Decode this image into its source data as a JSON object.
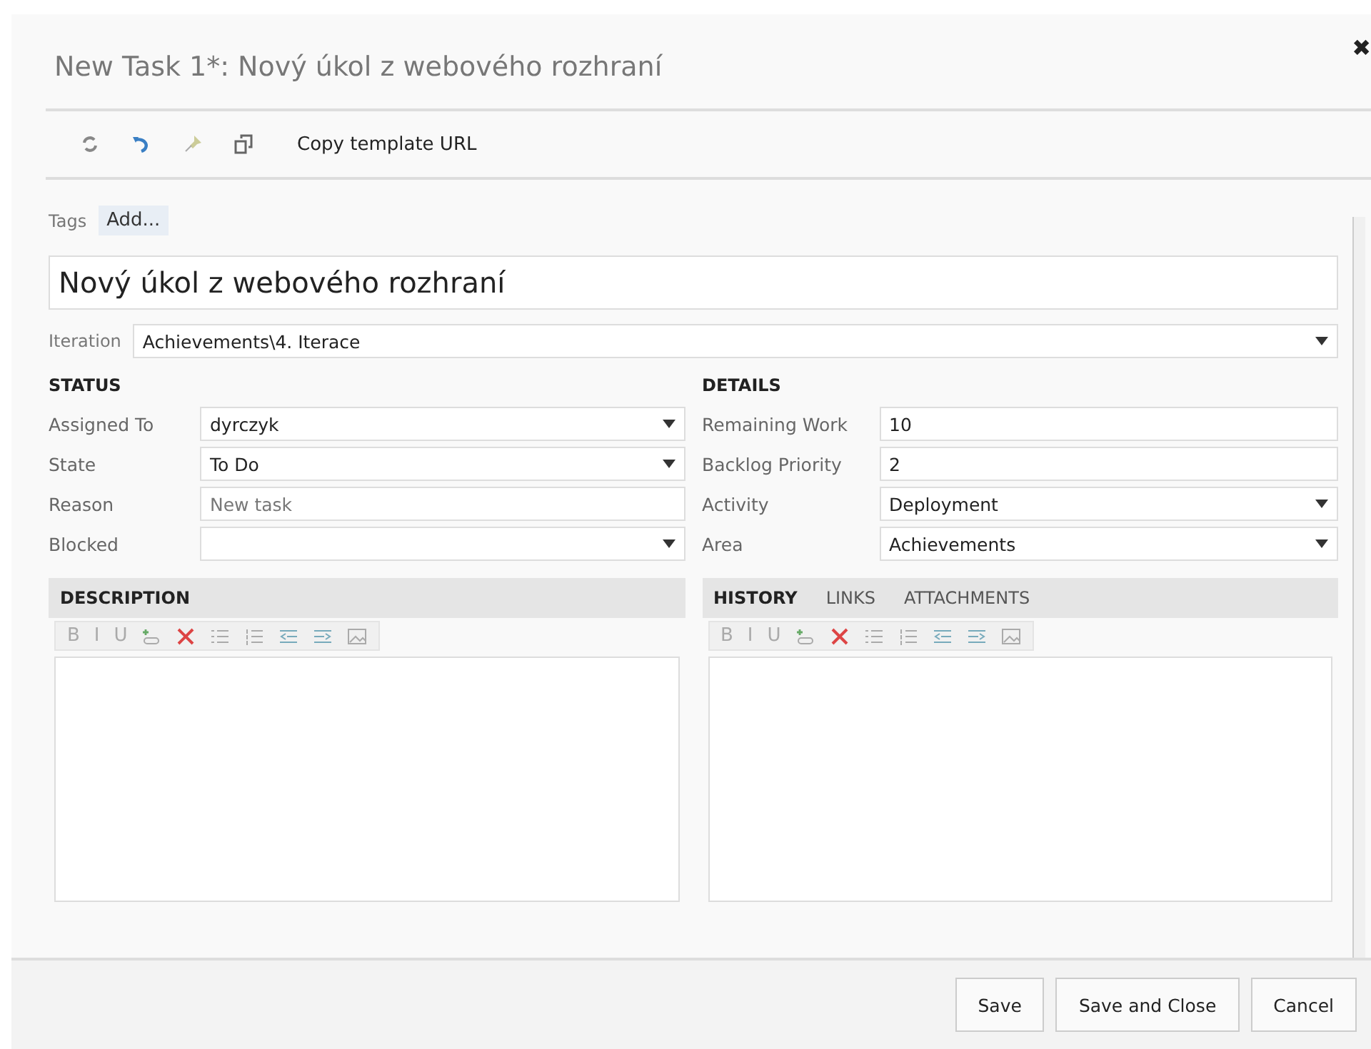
{
  "dialog": {
    "title": "New Task 1*: Nový úkol z webového rozhraní",
    "close": "✖"
  },
  "toolbar": {
    "link": "Copy template URL"
  },
  "tags": {
    "label": "Tags",
    "add": "Add..."
  },
  "title_field": {
    "value": "Nový úkol z webového rozhraní"
  },
  "iteration": {
    "label": "Iteration",
    "value": "Achievements\\4. Iterace"
  },
  "status": {
    "heading": "STATUS",
    "fields": [
      {
        "label": "Assigned To",
        "value": "dyrczyk",
        "kind": "dropdown"
      },
      {
        "label": "State",
        "value": "To Do",
        "kind": "dropdown"
      },
      {
        "label": "Reason",
        "value": "New task",
        "kind": "readonly"
      },
      {
        "label": "Blocked",
        "kind": "dropdown"
      }
    ]
  },
  "details": {
    "heading": "DETAILS",
    "fields": [
      {
        "label": "Remaining Work",
        "value": "10",
        "kind": "text"
      },
      {
        "label": "Backlog Priority",
        "value": "2",
        "kind": "text"
      },
      {
        "label": "Activity",
        "value": "Deployment",
        "kind": "dropdown"
      },
      {
        "label": "Area",
        "value": "Achievements",
        "kind": "dropdown"
      }
    ]
  },
  "description": {
    "heading": "DESCRIPTION",
    "format_buttons": [
      "B",
      "I",
      "U"
    ]
  },
  "history": {
    "tabs": [
      {
        "label": "HISTORY",
        "selected": true
      },
      {
        "label": "LINKS",
        "selected": false
      },
      {
        "label": "ATTACHMENTS",
        "selected": false
      }
    ],
    "format_buttons": [
      "B",
      "I",
      "U"
    ]
  },
  "buttons": [
    "Save",
    "Save and Close",
    "Cancel"
  ]
}
